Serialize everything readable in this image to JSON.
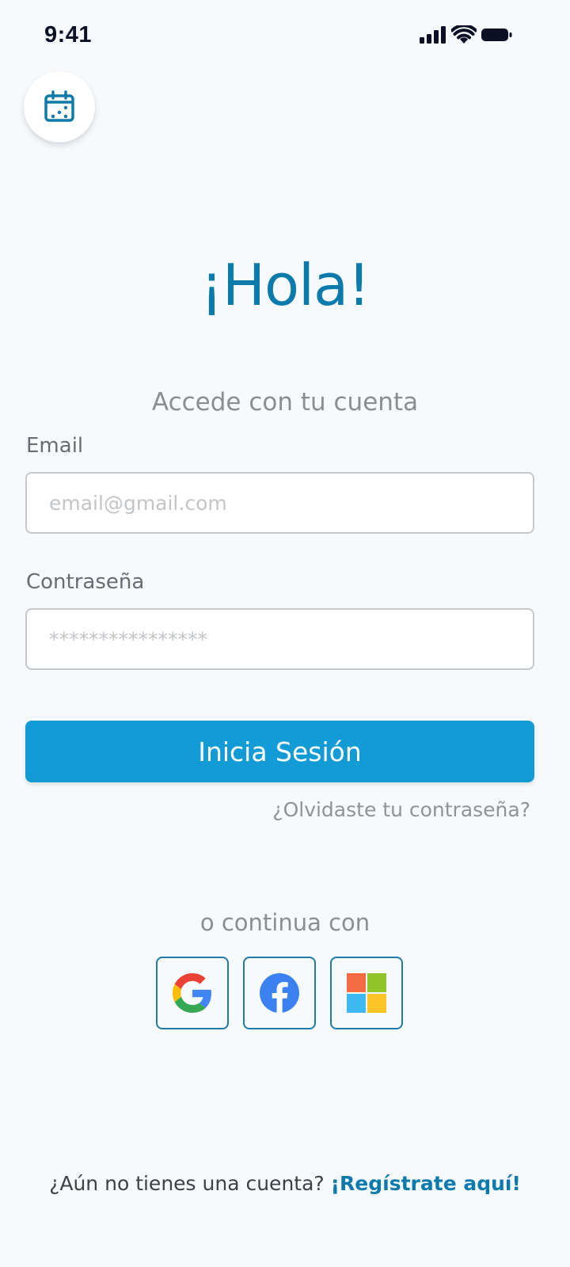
{
  "status_bar": {
    "time": "9:41",
    "icons": [
      "cellular-signal-icon",
      "wifi-icon",
      "battery-icon"
    ]
  },
  "header": {
    "calendar_icon": "calendar-icon"
  },
  "login": {
    "greeting": "¡Hola!",
    "subtitle": "Accede con tu cuenta",
    "email_label": "Email",
    "email_placeholder": "email@gmail.com",
    "email_value": "",
    "password_label": "Contraseña",
    "password_placeholder": "****************",
    "password_value": "",
    "submit_label": "Inicia Sesión",
    "forgot_label": "¿Olvidaste tu contraseña?"
  },
  "social": {
    "divider": "o continua con",
    "providers": [
      "google-icon",
      "facebook-icon",
      "microsoft-icon"
    ]
  },
  "signup": {
    "prompt": "¿Aún no tienes una cuenta?",
    "link": "¡Regístrate aquí!"
  },
  "colors": {
    "primary": "#139bd6",
    "heading": "#0d7aac",
    "background": "#f6fafd",
    "social_border": "#1f7aa6"
  }
}
